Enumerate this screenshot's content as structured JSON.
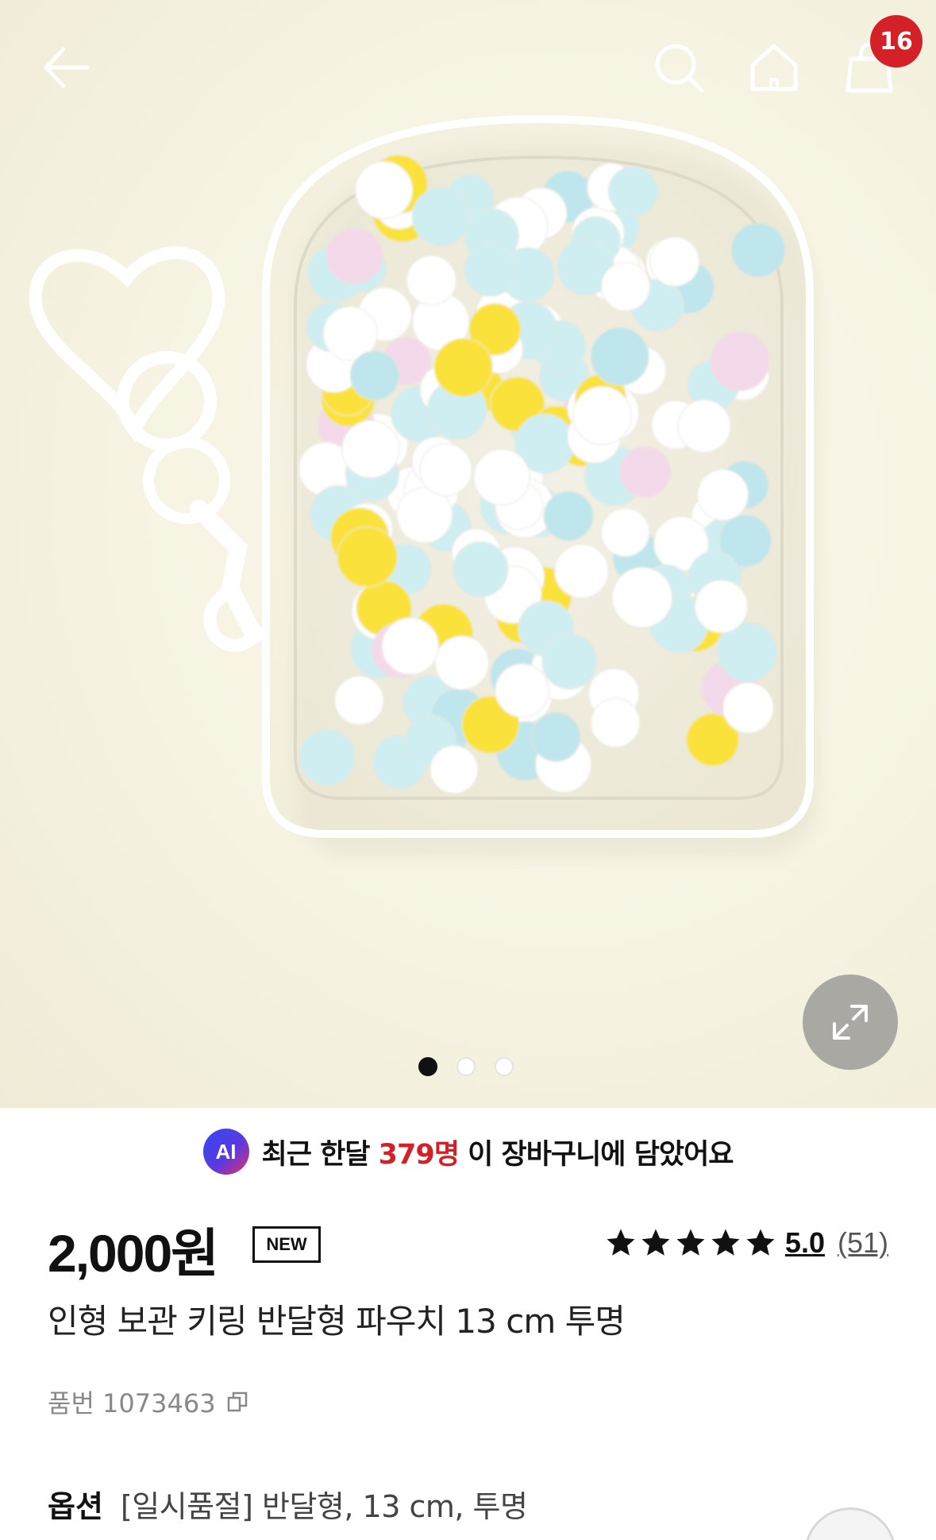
{
  "header": {
    "back_icon": "arrow-left-icon",
    "search_icon": "search-icon",
    "home_icon": "home-icon",
    "cart_icon": "shopping-bag-icon",
    "cart_count": "16"
  },
  "gallery": {
    "image_alt": "clear half-moon pouch keyring filled with pastel pom-poms",
    "expand_icon": "expand-icon",
    "page_count": 3,
    "active_index": 0
  },
  "ai_banner": {
    "badge": "AI",
    "text_before": "최근 한달 ",
    "highlight": "379명",
    "text_after": " 이 장바구니에 담았어요"
  },
  "product": {
    "price": "2,000원",
    "new_tag": "NEW",
    "rating_score": "5.0",
    "rating_count": "(51)",
    "stars": 5,
    "title": "인형 보관 키링 반달형 파우치 13 cm 투명",
    "sku": "품번 1073463",
    "copy_icon": "copy-icon"
  },
  "option": {
    "label": "옵션",
    "value": "[일시품절] 반달형, 13 cm, 투명"
  },
  "colors": {
    "accent_red": "#d42127",
    "text_primary": "#111111",
    "text_muted": "#888888"
  }
}
